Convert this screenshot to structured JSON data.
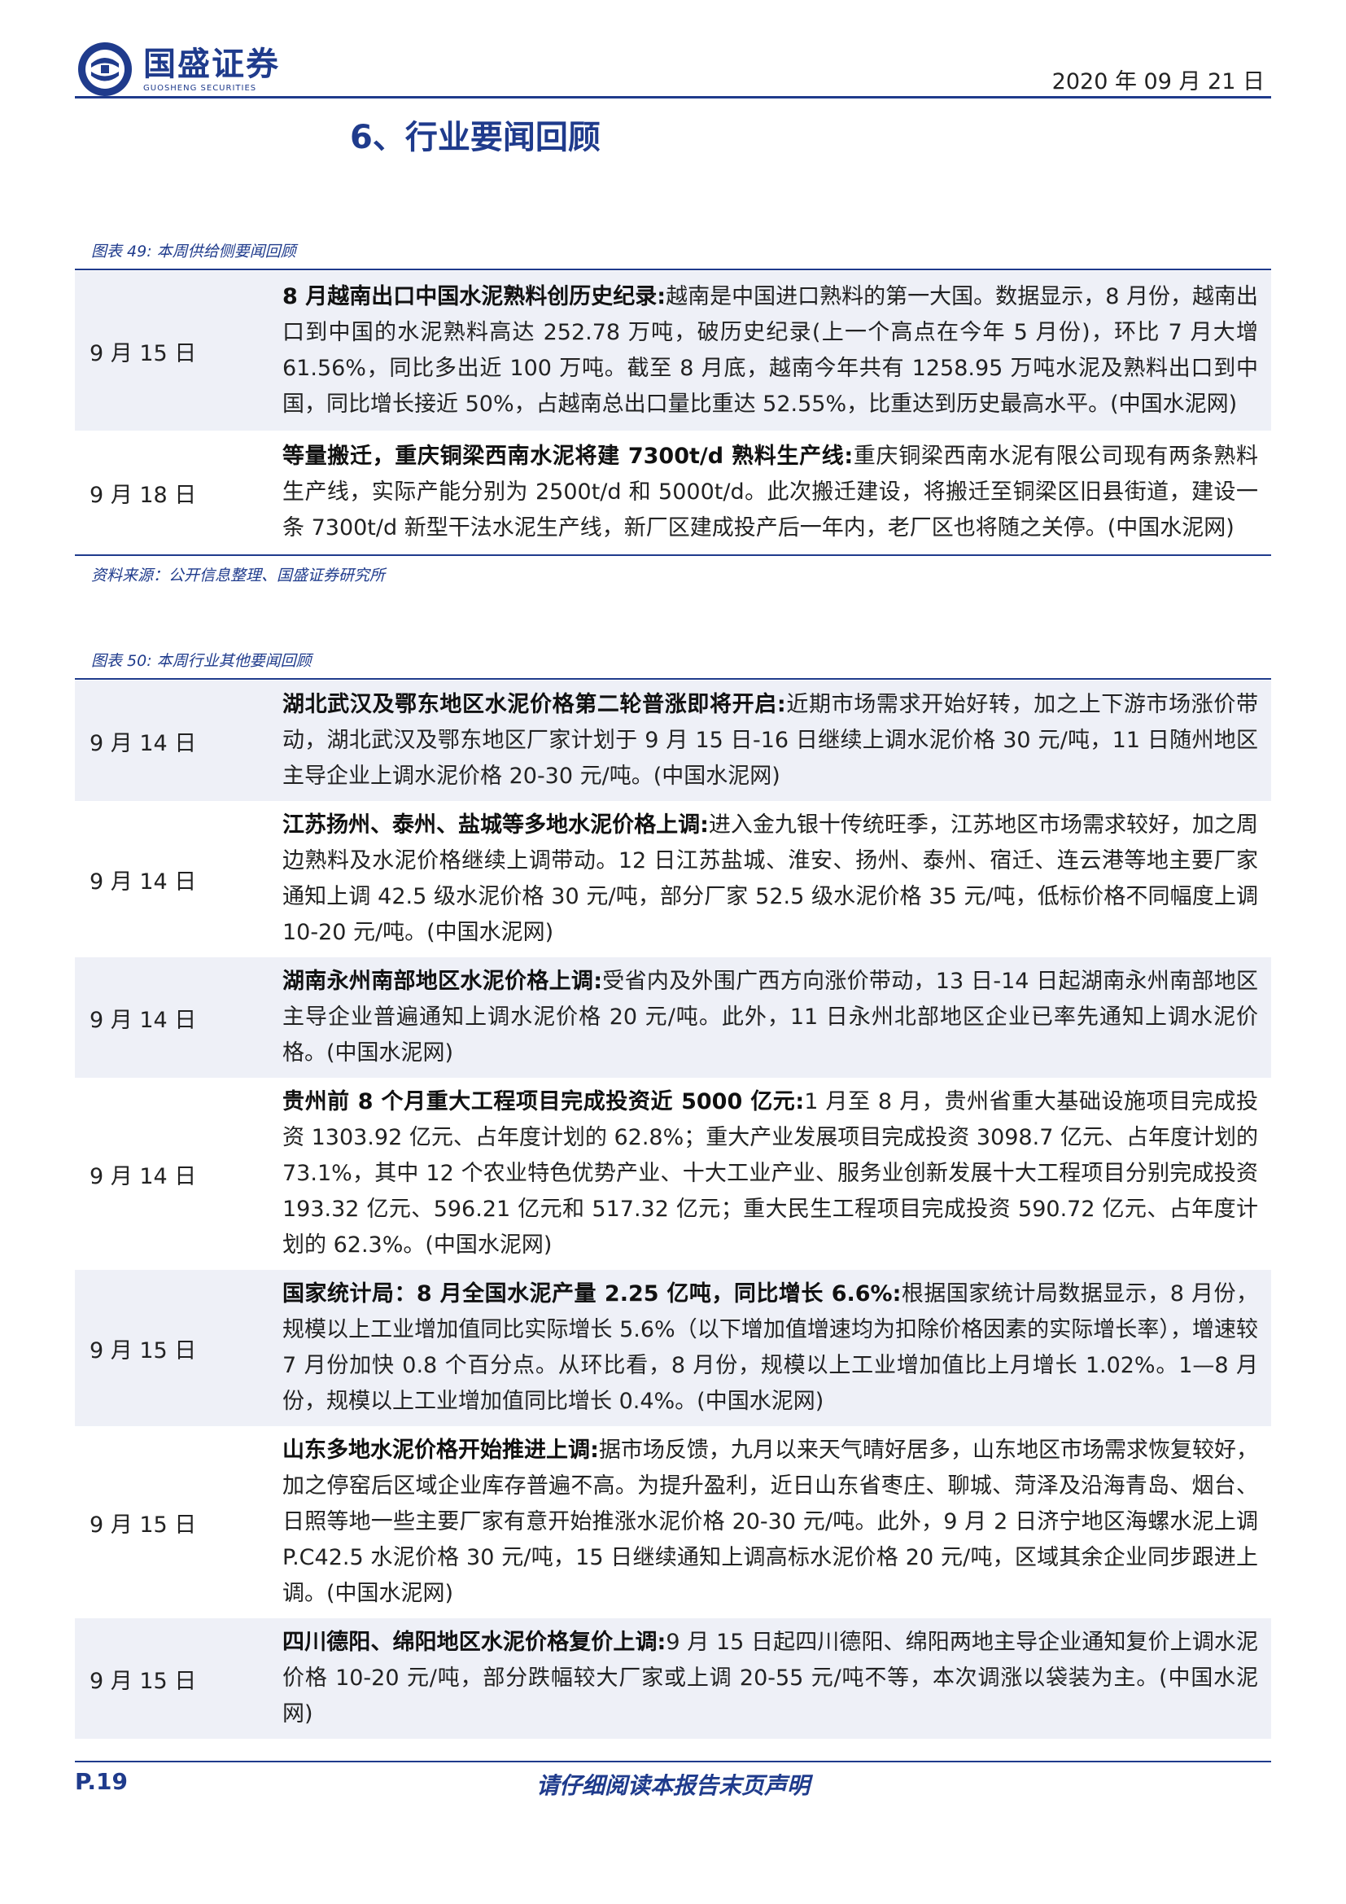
{
  "header": {
    "brand_cn": "国盛证券",
    "brand_en": "GUOSHENG SECURITIES",
    "date": "2020 年 09 月 21 日"
  },
  "section_title": "6、行业要闻回顾",
  "fig49": {
    "caption": "图表 49: 本周供给侧要闻回顾",
    "rows": [
      {
        "date": "9 月 15 日",
        "headline": "8 月越南出口中国水泥熟料创历史纪录:",
        "body": "越南是中国进口熟料的第一大国。数据显示，8 月份，越南出口到中国的水泥熟料高达 252.78 万吨，破历史纪录(上一个高点在今年 5 月份)，环比 7 月大增 61.56%，同比多出近 100 万吨。截至 8 月底，越南今年共有 1258.95 万吨水泥及熟料出口到中国，同比增长接近 50%，占越南总出口量比重达 52.55%，比重达到历史最高水平。(中国水泥网)"
      },
      {
        "date": "9 月 18 日",
        "headline": "等量搬迁，重庆铜梁西南水泥将建 7300t/d 熟料生产线:",
        "body": "重庆铜梁西南水泥有限公司现有两条熟料生产线，实际产能分别为 2500t/d 和 5000t/d。此次搬迁建设，将搬迁至铜梁区旧县街道，建设一条 7300t/d 新型干法水泥生产线，新厂区建成投产后一年内，老厂区也将随之关停。(中国水泥网)"
      }
    ],
    "source": "资料来源：公开信息整理、国盛证券研究所"
  },
  "fig50": {
    "caption": "图表 50: 本周行业其他要闻回顾",
    "rows": [
      {
        "date": "9 月 14 日",
        "headline": "湖北武汉及鄂东地区水泥价格第二轮普涨即将开启:",
        "body": "近期市场需求开始好转，加之上下游市场涨价带动，湖北武汉及鄂东地区厂家计划于 9 月 15 日-16 日继续上调水泥价格 30 元/吨，11 日随州地区主导企业上调水泥价格 20-30 元/吨。(中国水泥网)"
      },
      {
        "date": "9 月 14 日",
        "headline": "江苏扬州、泰州、盐城等多地水泥价格上调:",
        "body": "进入金九银十传统旺季，江苏地区市场需求较好，加之周边熟料及水泥价格继续上调带动。12 日江苏盐城、淮安、扬州、泰州、宿迁、连云港等地主要厂家通知上调 42.5 级水泥价格 30 元/吨，部分厂家 52.5 级水泥价格 35 元/吨，低标价格不同幅度上调 10-20 元/吨。(中国水泥网)"
      },
      {
        "date": "9 月 14 日",
        "headline": "湖南永州南部地区水泥价格上调:",
        "body": "受省内及外围广西方向涨价带动，13 日-14 日起湖南永州南部地区主导企业普遍通知上调水泥价格 20 元/吨。此外，11 日永州北部地区企业已率先通知上调水泥价格。(中国水泥网)"
      },
      {
        "date": "9 月 14 日",
        "headline": "贵州前 8 个月重大工程项目完成投资近 5000 亿元:",
        "body": "1 月至 8 月，贵州省重大基础设施项目完成投资 1303.92 亿元、占年度计划的 62.8%；重大产业发展项目完成投资 3098.7 亿元、占年度计划的 73.1%，其中 12 个农业特色优势产业、十大工业产业、服务业创新发展十大工程项目分别完成投资 193.32 亿元、596.21 亿元和 517.32 亿元；重大民生工程项目完成投资 590.72 亿元、占年度计划的 62.3%。(中国水泥网)"
      },
      {
        "date": "9 月 15 日",
        "headline": "国家统计局：8 月全国水泥产量 2.25 亿吨，同比增长 6.6%:",
        "body": "根据国家统计局数据显示，8 月份，规模以上工业增加值同比实际增长 5.6%（以下增加值增速均为扣除价格因素的实际增长率），增速较 7 月份加快 0.8 个百分点。从环比看，8 月份，规模以上工业增加值比上月增长 1.02%。1—8 月份，规模以上工业增加值同比增长 0.4%。(中国水泥网)"
      },
      {
        "date": "9 月 15 日",
        "headline": "山东多地水泥价格开始推进上调:",
        "body": "据市场反馈，九月以来天气晴好居多，山东地区市场需求恢复较好，加之停窑后区域企业库存普遍不高。为提升盈利，近日山东省枣庄、聊城、菏泽及沿海青岛、烟台、日照等地一些主要厂家有意开始推涨水泥价格 20-30 元/吨。此外，9 月 2 日济宁地区海螺水泥上调 P.C42.5 水泥价格 30 元/吨，15 日继续通知上调高标水泥价格 20 元/吨，区域其余企业同步跟进上调。(中国水泥网)"
      },
      {
        "date": "9 月 15 日",
        "headline": "四川德阳、绵阳地区水泥价格复价上调:",
        "body": "9 月 15 日起四川德阳、绵阳两地主导企业通知复价上调水泥价格 10-20 元/吨，部分跌幅较大厂家或上调 20-55 元/吨不等，本次调涨以袋装为主。(中国水泥网)"
      }
    ]
  },
  "footer": {
    "page": "P.19",
    "disclaimer": "请仔细阅读本报告末页声明"
  }
}
